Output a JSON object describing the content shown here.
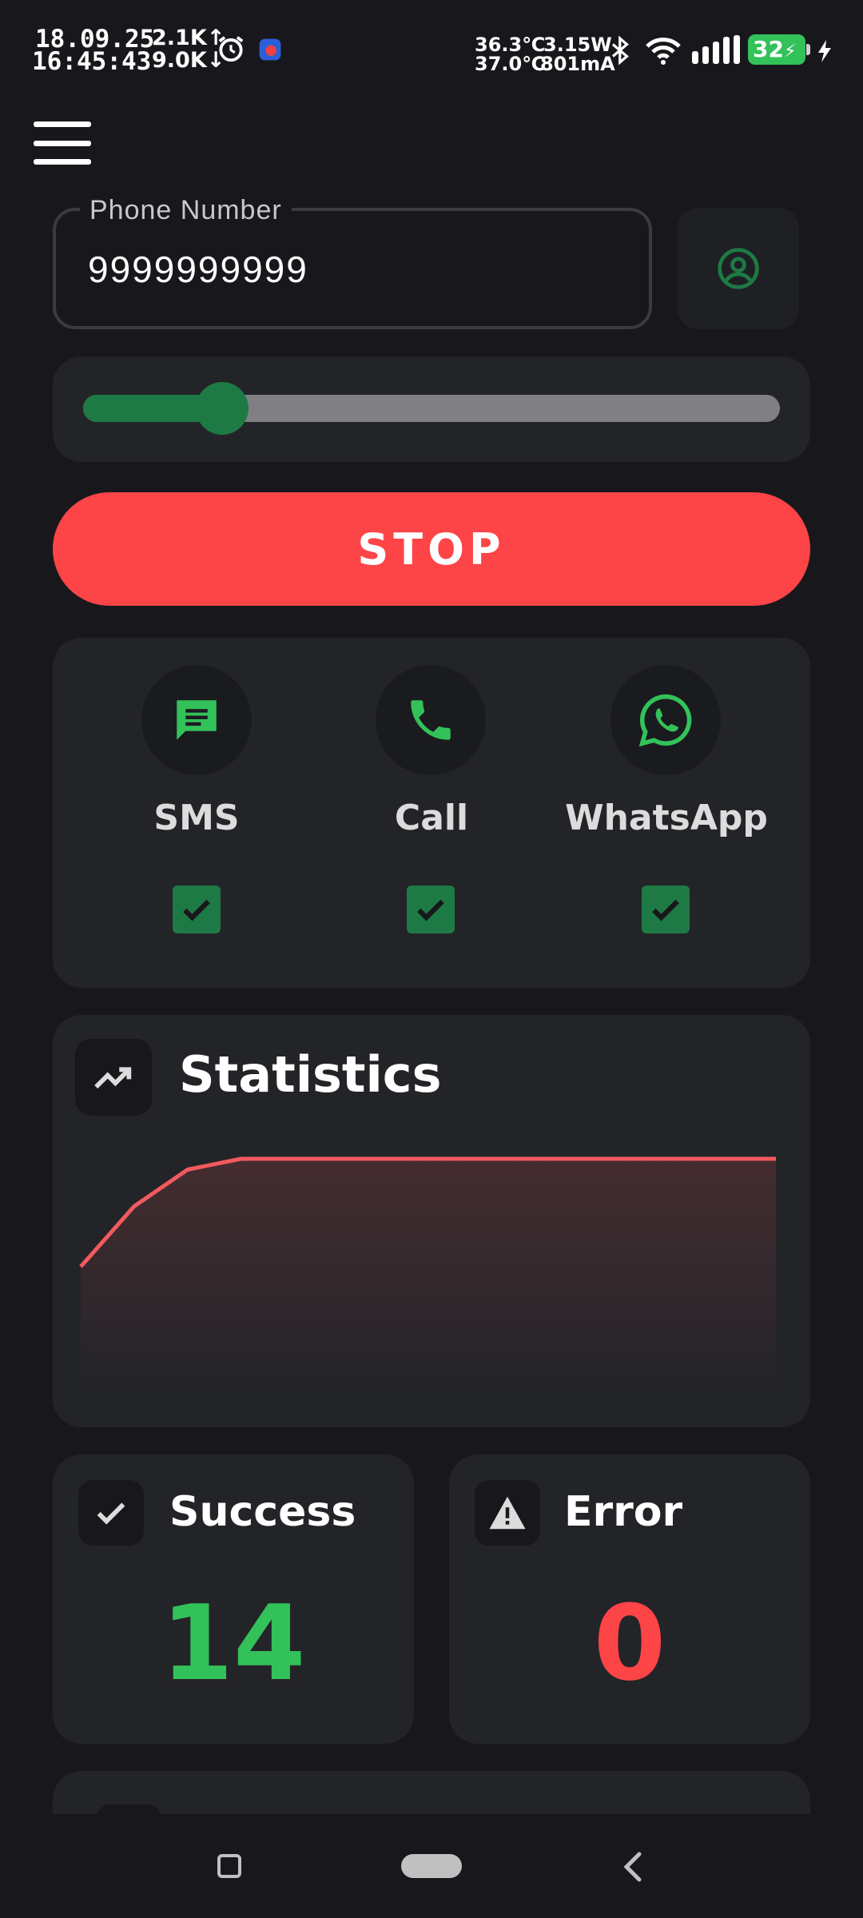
{
  "status_bar": {
    "date": "18.09.25",
    "time": "16:45:43",
    "upload_speed": "2.1K↑",
    "download_speed": "9.0K↓",
    "temp_1": "36.3℃",
    "temp_2": "37.0℃",
    "power": "3.15W",
    "current": "801mA",
    "battery": "32"
  },
  "phone": {
    "label": "Phone Number",
    "value": "9999999999"
  },
  "slider": {
    "value_fraction": 0.2
  },
  "stop_button": {
    "label": "STOP"
  },
  "channels": [
    {
      "label": "SMS",
      "checked": true
    },
    {
      "label": "Call",
      "checked": true
    },
    {
      "label": "WhatsApp",
      "checked": true
    }
  ],
  "statistics": {
    "title": "Statistics",
    "chart_data": {
      "type": "area",
      "x": [
        0,
        1,
        2,
        3,
        4,
        5,
        6,
        7,
        8,
        9,
        10,
        11,
        12,
        13
      ],
      "values": [
        0.5,
        0.78,
        0.95,
        1,
        1,
        1,
        1,
        1,
        1,
        1,
        1,
        1,
        1,
        1
      ],
      "color": "#f25a5e"
    }
  },
  "success": {
    "label": "Success",
    "count": "14",
    "color": "#33c15a"
  },
  "error": {
    "label": "Error",
    "count": "0",
    "color": "#fd4447"
  },
  "colors": {
    "background": "#18181c",
    "card": "#232428",
    "accent_green": "#1e7a44",
    "stop_red": "#fd4447"
  }
}
